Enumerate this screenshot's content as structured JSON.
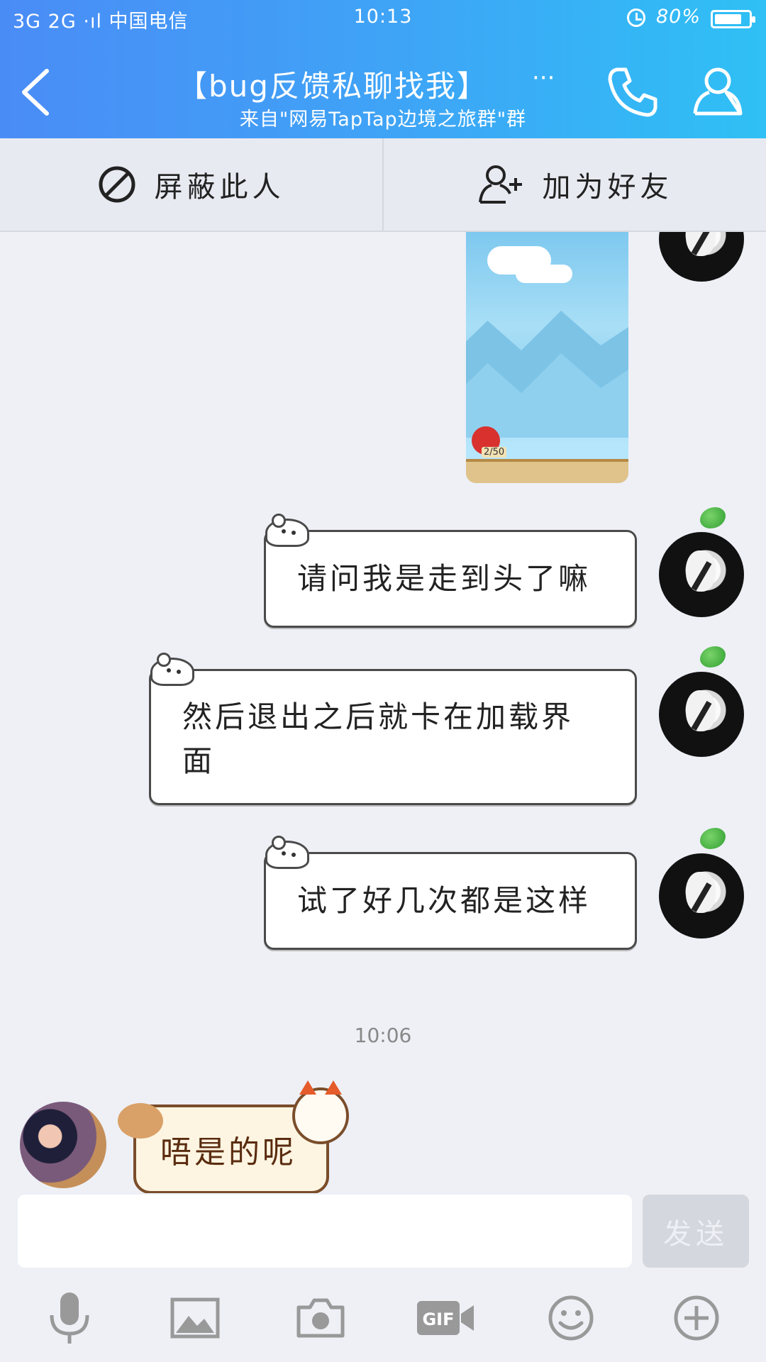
{
  "status_bar": {
    "carrier": "3G 2G ·ıl 中国电信",
    "time": "10:13",
    "battery": "80%"
  },
  "header": {
    "title": "【bug反馈私聊找我】",
    "more": "···",
    "subtitle": "来自\"网易TapTap边境之旅群\"群"
  },
  "actions": {
    "block_label": "屏蔽此人",
    "add_friend_label": "加为好友"
  },
  "game_image": {
    "counter": "2/50"
  },
  "messages": [
    {
      "text": "请问我是走到头了嘛"
    },
    {
      "text": "然后退出之后就卡在加载界面"
    },
    {
      "text": "试了好几次都是这样"
    }
  ],
  "timestamp": "10:06",
  "reply": {
    "text": "唔是的呢"
  },
  "input": {
    "placeholder": "",
    "send_label": "发送"
  },
  "toolbar": {
    "icons": [
      "microphone-icon",
      "image-icon",
      "camera-icon",
      "gif-icon",
      "emoji-icon",
      "plus-icon"
    ]
  },
  "colors": {
    "header_start": "#4a8cf6",
    "header_end": "#2fc0f5",
    "background": "#eef0f6",
    "send_disabled": "#d5d7de"
  }
}
